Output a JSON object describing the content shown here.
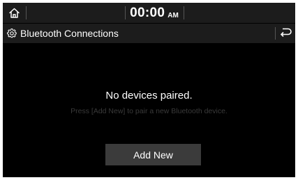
{
  "status_bar": {
    "home_icon": "home-icon",
    "time": "00:00",
    "ampm": "AM"
  },
  "header": {
    "settings_icon": "gear-icon",
    "title": "Bluetooth Connections",
    "back_icon": "back-arrow-icon"
  },
  "main": {
    "message": "No devices paired.",
    "hint": "Press [Add New] to pair a new Bluetooth device.",
    "add_new_label": "Add New"
  },
  "colors": {
    "background": "#000000",
    "bar_background": "#1c1c1c",
    "button_background": "#3b3b3b",
    "hint_text": "#3a3a3a"
  }
}
